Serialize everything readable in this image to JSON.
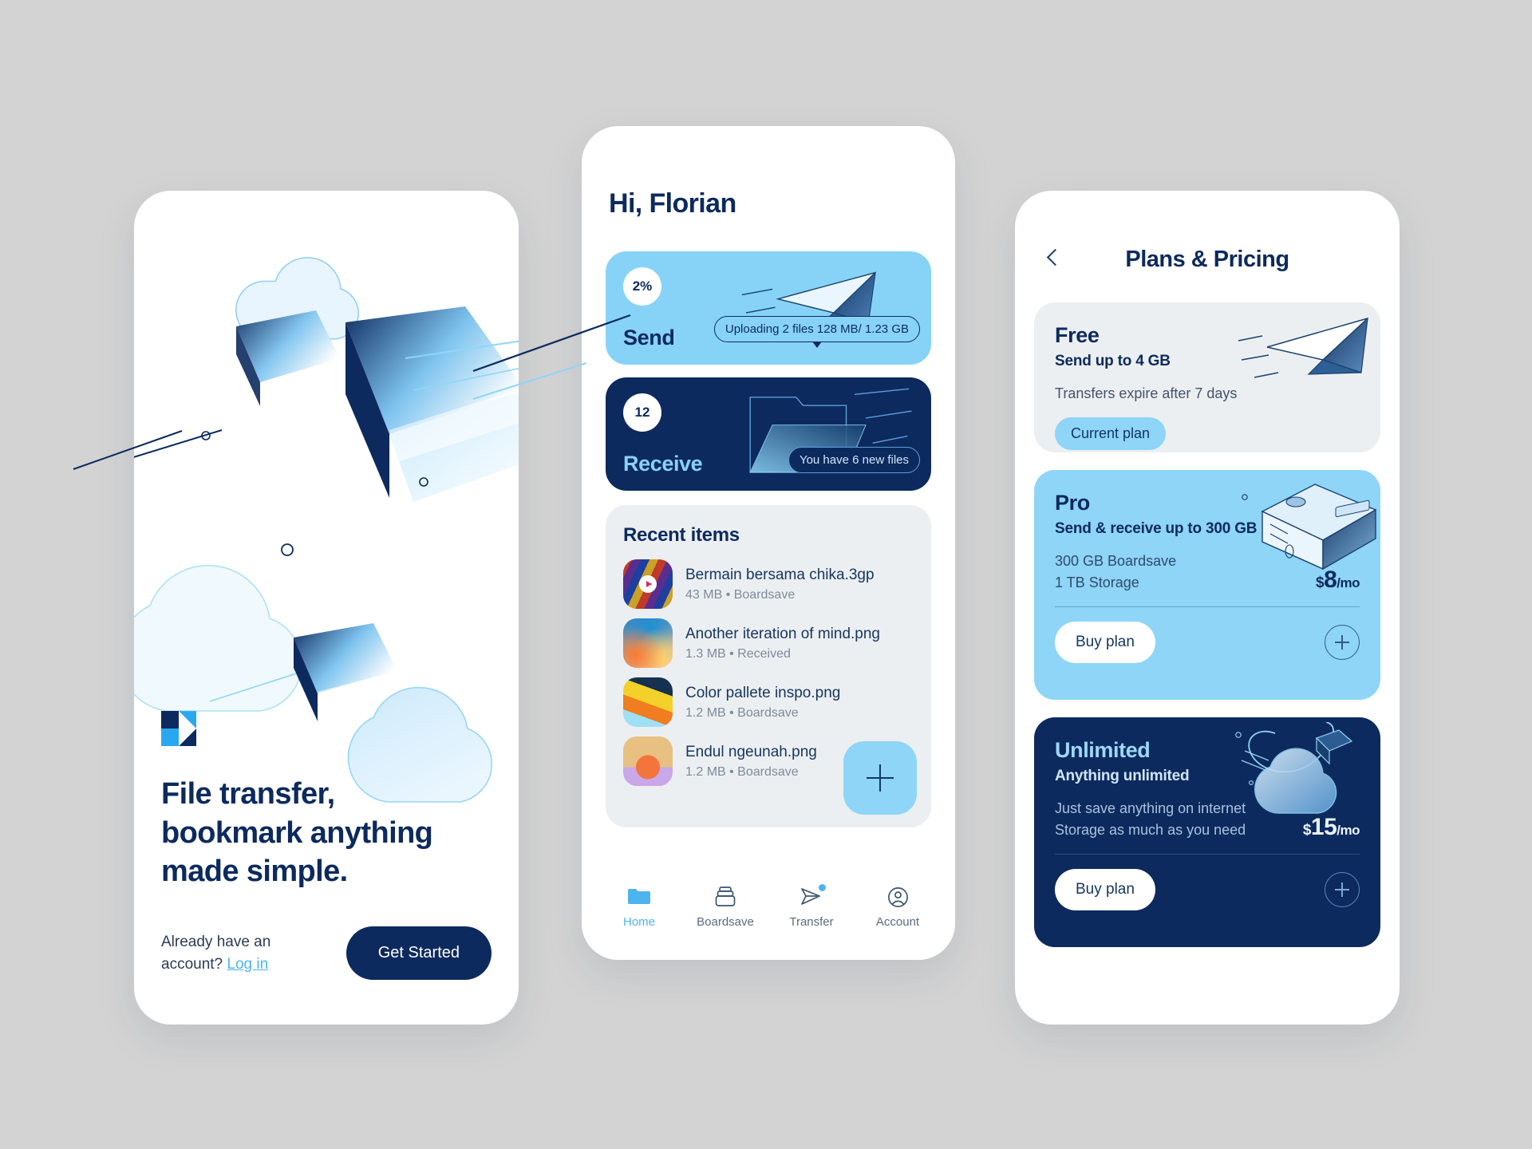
{
  "brand": {
    "logo_name": "boardsave-logo",
    "navy": "#0d2a5e",
    "sky": "#8ed5f8",
    "accent": "#4db4ef"
  },
  "onboarding": {
    "headline": "File transfer, bookmark anything made simple.",
    "headline_lines": [
      "File transfer,",
      "bookmark anything",
      "made simple."
    ],
    "account_prompt": "Already have an account?",
    "login_label": "Log in",
    "cta_label": "Get Started"
  },
  "home": {
    "greeting": "Hi, Florian",
    "send_card": {
      "percent": "2%",
      "title": "Send",
      "status": "Uploading 2 files 128 MB/ 1.23 GB"
    },
    "receive_card": {
      "count": "12",
      "title": "Receive",
      "status": "You have 6 new files"
    },
    "recent": {
      "title": "Recent items",
      "items": [
        {
          "name": "Bermain bersama chika.3gp",
          "size": "43 MB",
          "source": "Boardsave",
          "meta": "43 MB  •  Boardsave",
          "kind": "video"
        },
        {
          "name": "Another iteration of mind.png",
          "size": "1.3 MB",
          "source": "Received",
          "meta": "1.3 MB  •  Received",
          "kind": "image"
        },
        {
          "name": "Color pallete inspo.png",
          "size": "1.2 MB",
          "source": "Boardsave",
          "meta": "1.2 MB  •  Boardsave",
          "kind": "image"
        },
        {
          "name": "Endul ngeunah.png",
          "size": "1.2 MB",
          "source": "Boardsave",
          "meta": "1.2 MB  •  Boardsave",
          "kind": "image"
        }
      ],
      "add_label": "+"
    },
    "tabs": [
      {
        "label": "Home",
        "icon": "folder-icon",
        "active": true
      },
      {
        "label": "Boardsave",
        "icon": "archive-icon",
        "active": false
      },
      {
        "label": "Transfer",
        "icon": "send-icon",
        "active": false,
        "badge": true
      },
      {
        "label": "Account",
        "icon": "user-circle-icon",
        "active": false
      }
    ]
  },
  "pricing": {
    "back_icon": "chevron-left-icon",
    "title": "Plans & Pricing",
    "plans": [
      {
        "name": "Free",
        "tagline": "Send up to 4 GB",
        "desc_lines": [
          "Transfers expire after 7 days"
        ],
        "badge_label": "Current plan",
        "illustration": "paper-plane-icon"
      },
      {
        "name": "Pro",
        "tagline": "Send & receive up to 300 GB",
        "desc_lines": [
          "300 GB Boardsave",
          "1 TB Storage"
        ],
        "price_currency": "$",
        "price_amount": "8",
        "price_period": "/mo",
        "buy_label": "Buy plan",
        "add_label": "+",
        "illustration": "server-box-icon"
      },
      {
        "name": "Unlimited",
        "tagline": "Anything unlimited",
        "desc_lines": [
          "Just save anything on internet",
          "Storage as much as you need"
        ],
        "price_currency": "$",
        "price_amount": "15",
        "price_period": "/mo",
        "buy_label": "Buy plan",
        "add_label": "+",
        "illustration": "infinity-cloud-icon"
      }
    ]
  }
}
